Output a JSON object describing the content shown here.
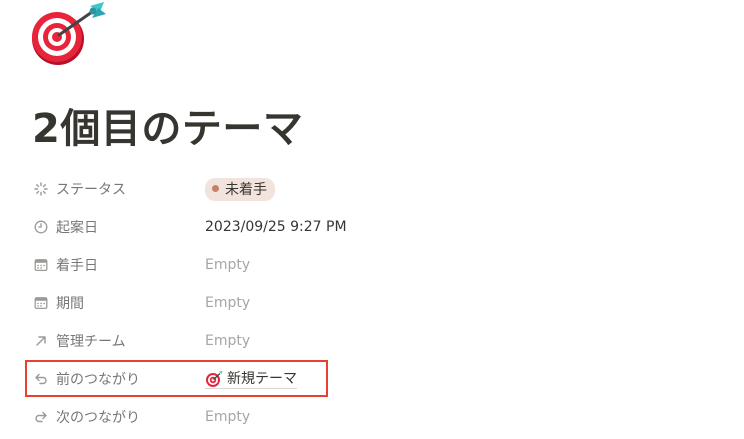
{
  "page": {
    "icon": "dart-target-icon",
    "title": "2個目のテーマ"
  },
  "properties": [
    {
      "name": "ステータス",
      "icon": "status-spinner-icon",
      "value": "未着手",
      "type": "status",
      "status_color": "#c4806a",
      "tag_bg": "#f2e4dd"
    },
    {
      "name": "起案日",
      "icon": "clock-icon",
      "value": "2023/09/25 9:27 PM",
      "type": "date"
    },
    {
      "name": "着手日",
      "icon": "calendar-icon",
      "value": "Empty",
      "type": "empty"
    },
    {
      "name": "期間",
      "icon": "calendar-icon",
      "value": "Empty",
      "type": "empty"
    },
    {
      "name": "管理チーム",
      "icon": "arrow-up-right-icon",
      "value": "Empty",
      "type": "empty"
    },
    {
      "name": "前のつながり",
      "icon": "relation-back-icon",
      "value": "新規テーマ",
      "type": "relation",
      "relation_icon": "dart-target-icon"
    },
    {
      "name": "次のつながり",
      "icon": "relation-forward-icon",
      "value": "Empty",
      "type": "empty"
    }
  ],
  "highlight": {
    "color": "#e8412c"
  }
}
